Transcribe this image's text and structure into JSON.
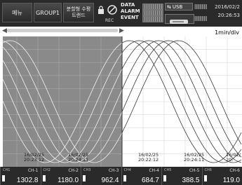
{
  "topbar": {
    "menu_label": "메뉴",
    "group_label": "GROUP1",
    "trend_label": "분할형 수평\n트랜드",
    "rec_label": "REC",
    "status": [
      {
        "label": "DATA"
      },
      {
        "label": "ALARM"
      },
      {
        "label": "EVENT"
      }
    ],
    "usb_label": "USB",
    "sd_icon": "sd-card-icon",
    "date": "2016/02/2",
    "time": "20:26:53"
  },
  "scale": {
    "time_per_div": "1min/div"
  },
  "chart": {
    "time_labels": [
      {
        "date": "16/02/25",
        "time": "20:23:12"
      },
      {
        "date": "16/02/25",
        "time": "20:24:11"
      },
      {
        "date": "16/02/25",
        "time": "20:22:12"
      },
      {
        "date": "16/02/25",
        "time": "20:24:11"
      },
      {
        "date": "16/02/",
        "time": "20:"
      }
    ],
    "colors": {
      "left_bg": "#8a8a8a",
      "right_bg": "#ffffff",
      "grid_left": "#a8a8a8",
      "grid_right": "#d8d8d8",
      "trace_left": "#f2f2f2",
      "trace_right": "#3a3a3a"
    }
  },
  "readouts": [
    {
      "tag": "CH1",
      "name": "CH-1",
      "value": "1302.8",
      "color": "#ffffff"
    },
    {
      "tag": "CH2",
      "name": "CH-2",
      "value": "1180.0",
      "color": "#ffffff"
    },
    {
      "tag": "CH3",
      "name": "CH-3",
      "value": "962.4",
      "color": "#ffffff"
    },
    {
      "tag": "CH4",
      "name": "CH-4",
      "value": "684.7",
      "color": "#ffffff"
    },
    {
      "tag": "CH5",
      "name": "CH-5",
      "value": "388.5",
      "color": "#ffffff"
    },
    {
      "tag": "CH6",
      "name": "CH-6",
      "value": "119.0",
      "color": "#ffffff"
    }
  ]
}
